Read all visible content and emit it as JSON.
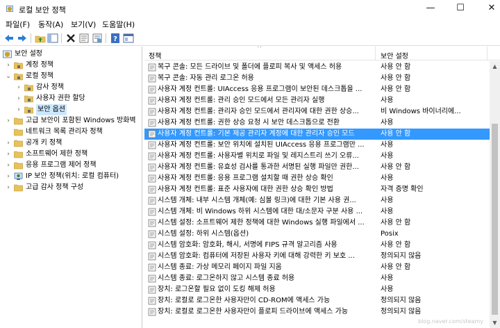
{
  "window": {
    "title": "로컬 보안 정책",
    "minimize_glyph": "—",
    "maximize_glyph": "☐",
    "close_glyph": "✕"
  },
  "menu": [
    "파일(F)",
    "동작(A)",
    "보기(V)",
    "도움말(H)"
  ],
  "toolbar": {
    "icons": [
      "back-arrow-icon",
      "forward-arrow-icon",
      "up-folder-icon",
      "show-hide-tree-icon",
      "delete-icon",
      "properties-icon",
      "export-list-icon",
      "help-icon",
      "console-view-icon"
    ]
  },
  "tree": [
    {
      "label": "보안 설정",
      "expanded": true,
      "icon": "security-settings-icon"
    },
    {
      "label": "계정 정책",
      "expanded": false,
      "icon": "folder-icon"
    },
    {
      "label": "로컬 정책",
      "expanded": true,
      "icon": "folder-icon"
    },
    {
      "label": "감사 정책",
      "expanded": false,
      "icon": "folder-icon"
    },
    {
      "label": "사용자 권한 할당",
      "expanded": false,
      "icon": "folder-icon"
    },
    {
      "label": "보안 옵션",
      "expanded": false,
      "icon": "folder-icon",
      "selected": true
    },
    {
      "label": "고급 보안이 포함된 Windows 방화벽",
      "expanded": false,
      "icon": "folder-icon"
    },
    {
      "label": "네트워크 목록 관리자 정책",
      "expanded": false,
      "icon": "folder-icon"
    },
    {
      "label": "공개 키 정책",
      "expanded": false,
      "icon": "folder-icon"
    },
    {
      "label": "소프트웨어 제한 정책",
      "expanded": false,
      "icon": "folder-icon"
    },
    {
      "label": "응용 프로그램 제어 정책",
      "expanded": false,
      "icon": "folder-icon"
    },
    {
      "label": "IP 보안 정책(위치: 로컬 컴퓨터)",
      "expanded": false,
      "icon": "ip-security-icon"
    },
    {
      "label": "고급 감사 정책 구성",
      "expanded": false,
      "icon": "folder-icon"
    }
  ],
  "list": {
    "columns": [
      "정책",
      "보안 설정"
    ],
    "sort_glyph": "^",
    "rows": [
      {
        "policy": "복구 콘솔: 모든 드라이브 및 폴더에 플로피 복사 및 액세스 허용",
        "setting": "사용 안 함"
      },
      {
        "policy": "복구 콘솔: 자동 관리 로그온 허용",
        "setting": "사용 안 함"
      },
      {
        "policy": "사용자 계정 컨트롤: UIAccess 응용 프로그램이 보안된 데스크톱을 ...",
        "setting": "사용 안 함"
      },
      {
        "policy": "사용자 계정 컨트롤: 관리 승인 모드에서 모든 관리자 실행",
        "setting": "사용"
      },
      {
        "policy": "사용자 계정 컨트롤: 관리자 승인 모드에서 관리자에 대한 권한 상승...",
        "setting": "비 Windows 바이너리에..."
      },
      {
        "policy": "사용자 계정 컨트롤: 권한 상승 요청 시 보안 데스크톱으로 전환",
        "setting": "사용"
      },
      {
        "policy": "사용자 계정 컨트롤: 기본 제공 관리자 계정에 대한 관리자 승인 모드",
        "setting": "사용 안 함",
        "selected": true
      },
      {
        "policy": "사용자 계정 컨트롤: 보안 위치에 설치된 UIAccess 응용 프로그램만 ...",
        "setting": "사용"
      },
      {
        "policy": "사용자 계정 컨트롤: 사용자별 위치로 파일 및 레지스트리 쓰기 오류...",
        "setting": "사용"
      },
      {
        "policy": "사용자 계정 컨트롤: 유효성 검사를 통과한 서명된 실행 파일만 권한...",
        "setting": "사용 안 함"
      },
      {
        "policy": "사용자 계정 컨트롤: 응용 프로그램 설치할 때 권한 상승 확인",
        "setting": "사용"
      },
      {
        "policy": "사용자 계정 컨트롤: 표준 사용자에 대한 권한 상승 확인 방법",
        "setting": "자격 증명 확인"
      },
      {
        "policy": "시스템 개체: 내부 시스템 개체(예: 심볼 링크)에 대한 기본 사용 권...",
        "setting": "사용"
      },
      {
        "policy": "시스템 개체: 비 Windows 하위 시스템에 대한 대/소문자 구분 사용 ...",
        "setting": "사용"
      },
      {
        "policy": "시스템 설정: 소프트웨어 제한 정책에 대한 Windows 실행 파일에서 ...",
        "setting": "사용 안 함"
      },
      {
        "policy": "시스템 설정: 하위 시스템(옵션)",
        "setting": "Posix"
      },
      {
        "policy": "시스템 암호화: 암호화, 해시, 서명에 FIPS 규격 알고리즘 사용",
        "setting": "사용 안 함"
      },
      {
        "policy": "시스템 암호화: 컴퓨터에 저장된 사용자 키에 대해 강력한 키 보호 ...",
        "setting": "정의되지 않음"
      },
      {
        "policy": "시스템 종료: 가상 메모리 페이지 파일 지움",
        "setting": "사용 안 함"
      },
      {
        "policy": "시스템 종료: 로그온하지 않고 시스템 종료 허용",
        "setting": "사용"
      },
      {
        "policy": "장치: 로그온할 필요 없이 도킹 해제 허용",
        "setting": "사용"
      },
      {
        "policy": "장치: 로컬로 로그온한 사용자만이 CD-ROM에 액세스 가능",
        "setting": "정의되지 않음"
      },
      {
        "policy": "장치: 로컬로 로그온한 사용자만이 플로피 드라이브에 액세스 가능",
        "setting": "정의되지 않음"
      }
    ]
  },
  "watermark": "blog.naver.com/steamy"
}
